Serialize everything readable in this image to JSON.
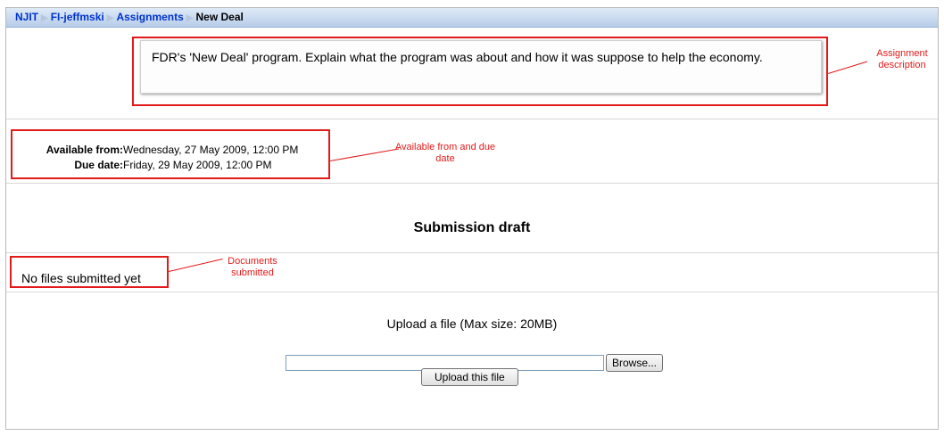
{
  "breadcrumb": {
    "items": [
      "NJIT",
      "FI-jeffmski",
      "Assignments"
    ],
    "separator": "▶",
    "current": "New Deal"
  },
  "description": {
    "text": "FDR's 'New Deal' program. Explain what the program was about and how it was suppose to help the economy."
  },
  "dates": {
    "available_label": "Available from:",
    "available_value": "Wednesday, 27 May 2009, 12:00 PM",
    "due_label": "Due date:",
    "due_value": "Friday, 29 May 2009, 12:00 PM"
  },
  "submission": {
    "title": "Submission draft",
    "no_files": "No files submitted yet",
    "upload_label": "Upload a file (Max size: 20MB)",
    "file_input_value": "",
    "browse_label": "Browse...",
    "upload_button_label": "Upload this file"
  },
  "annotations": {
    "assignment_description": "Assignment description",
    "available_due": "Available from and due date",
    "documents_submitted": "Documents submitted",
    "color": "#e31a1a"
  }
}
